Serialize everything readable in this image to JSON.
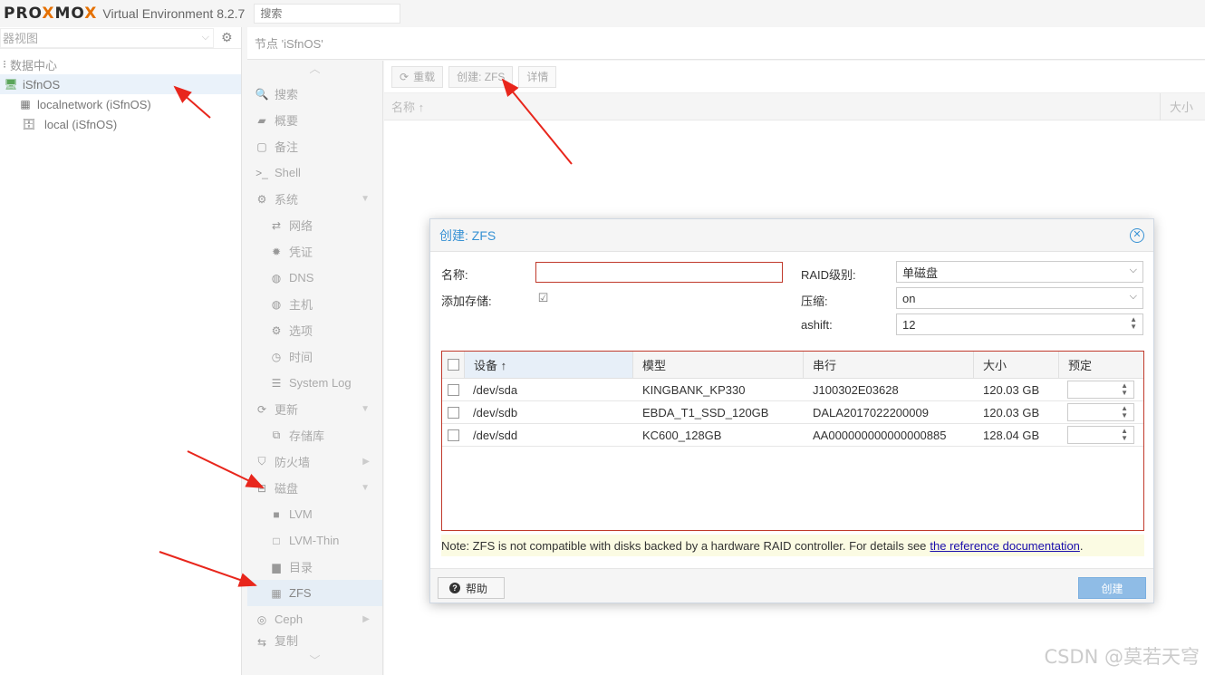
{
  "header": {
    "logo_pre": "PRO",
    "logo_x": "X",
    "logo_mid": "MO",
    "logo_x2": "X",
    "version": "Virtual Environment 8.2.7",
    "search_placeholder": "搜索"
  },
  "tree": {
    "view_label": "器视图",
    "items": [
      {
        "label": "数据中心"
      },
      {
        "label": "iSfnOS"
      },
      {
        "label": "localnetwork (iSfnOS)"
      },
      {
        "label": "local (iSfnOS)"
      }
    ]
  },
  "main": {
    "breadcrumb": "节点 'iSfnOS'"
  },
  "nav": {
    "items": [
      {
        "label": "搜索",
        "icon": "search-icon"
      },
      {
        "label": "概要",
        "icon": "book-icon"
      },
      {
        "label": "备注",
        "icon": "note-icon"
      },
      {
        "label": "Shell",
        "icon": "terminal-icon"
      },
      {
        "label": "系统",
        "icon": "cogs-icon"
      },
      {
        "label": "网络",
        "icon": "exchange-icon"
      },
      {
        "label": "凭证",
        "icon": "certificate-icon"
      },
      {
        "label": "DNS",
        "icon": "globe-icon"
      },
      {
        "label": "主机",
        "icon": "globe-icon"
      },
      {
        "label": "选项",
        "icon": "gear-icon"
      },
      {
        "label": "时间",
        "icon": "clock-icon"
      },
      {
        "label": "System Log",
        "icon": "list-icon"
      },
      {
        "label": "更新",
        "icon": "refresh-icon"
      },
      {
        "label": "存储库",
        "icon": "files-icon"
      },
      {
        "label": "防火墙",
        "icon": "shield-icon"
      },
      {
        "label": "磁盘",
        "icon": "hdd-icon"
      },
      {
        "label": "LVM",
        "icon": "square-icon"
      },
      {
        "label": "LVM-Thin",
        "icon": "square-outline-icon"
      },
      {
        "label": "目录",
        "icon": "folder-icon"
      },
      {
        "label": "ZFS",
        "icon": "th-large-icon"
      },
      {
        "label": "Ceph",
        "icon": "ceph-icon"
      },
      {
        "label": "复制",
        "icon": "retweet-icon"
      }
    ]
  },
  "toolbar": {
    "reload": "重载",
    "create_zfs": "创建: ZFS",
    "detail": "详情"
  },
  "grid": {
    "name_col": "名称 ↑",
    "size_col": "大小"
  },
  "dialog": {
    "title": "创建: ZFS",
    "name_label": "名称:",
    "add_storage_label": "添加存储:",
    "raid_label": "RAID级别:",
    "raid_value": "单磁盘",
    "compress_label": "压缩:",
    "compress_value": "on",
    "ashift_label": "ashift:",
    "ashift_value": "12",
    "columns": {
      "device": "设备 ↑",
      "model": "模型",
      "serial": "串行",
      "size": "大小",
      "order": "预定"
    },
    "disks": [
      {
        "device": "/dev/sda",
        "model": "KINGBANK_KP330",
        "serial": "J100302E03628",
        "size": "120.03 GB"
      },
      {
        "device": "/dev/sdb",
        "model": "EBDA_T1_SSD_120GB",
        "serial": "DALA2017022200009",
        "size": "120.03 GB"
      },
      {
        "device": "/dev/sdd",
        "model": "KC600_128GB",
        "serial": "AA000000000000000885",
        "size": "128.04 GB"
      }
    ],
    "note_text": "Note: ZFS is not compatible with disks backed by a hardware RAID controller. For details see",
    "note_link": "the reference documentation",
    "note_end": ".",
    "help": "帮助",
    "create": "创建"
  },
  "watermark": "CSDN @莫若天穹",
  "colors": {
    "accent": "#3892d4",
    "invalid": "#c0392b",
    "logo_x": "#e57000",
    "arrow": "#e8261c"
  }
}
